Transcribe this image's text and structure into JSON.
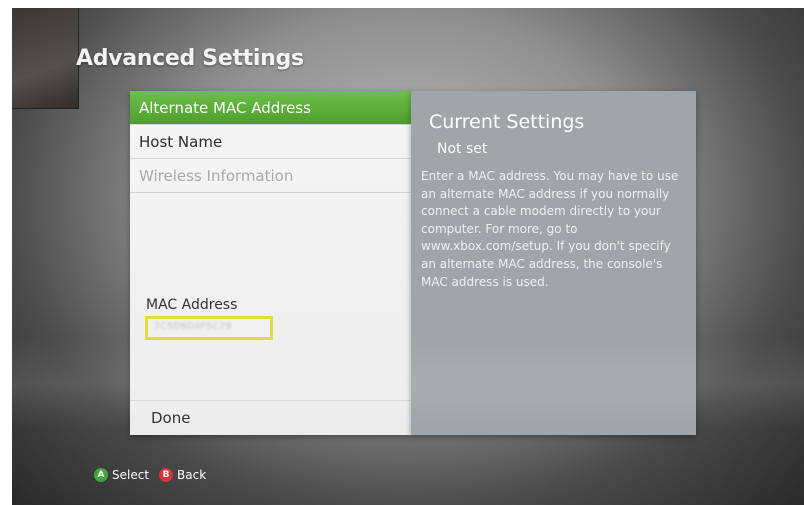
{
  "header": {
    "title": "Advanced Settings"
  },
  "menu": {
    "items": [
      {
        "label": "Alternate MAC Address",
        "state": "selected"
      },
      {
        "label": "Host Name",
        "state": "normal"
      },
      {
        "label": "Wireless Information",
        "state": "disabled"
      }
    ],
    "mac_label": "MAC Address",
    "mac_value": "7C5D8D4F5C79",
    "done_label": "Done"
  },
  "info": {
    "heading": "Current Settings",
    "value": "Not set",
    "description": "Enter a MAC address. You may have to use an alternate MAC address if you normally connect a cable modem directly to your computer. For more, go to www.xbox.com/setup. If you don't specify an alternate MAC address, the console's MAC address is used."
  },
  "hints": {
    "a_glyph": "A",
    "a_label": "Select",
    "b_glyph": "B",
    "b_label": "Back"
  },
  "colors": {
    "accent_green": "#5aad38",
    "highlight_yellow": "#e4dc3a",
    "button_a": "#3fa73f",
    "button_b": "#d8343a"
  }
}
